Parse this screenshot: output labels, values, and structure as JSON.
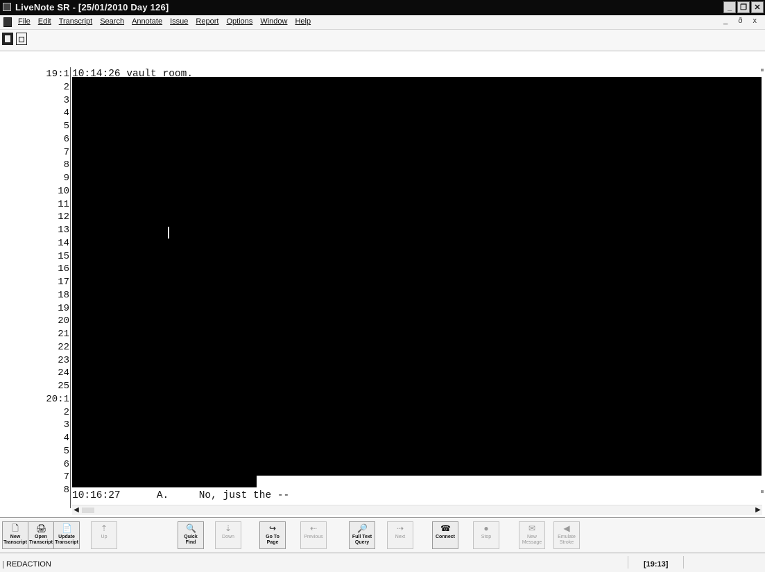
{
  "window": {
    "title": "LiveNote SR - [25/01/2010  Day 126]",
    "controls": [
      "minimize",
      "restore",
      "close"
    ]
  },
  "menu": {
    "items": [
      "File",
      "Edit",
      "Transcript",
      "Search",
      "Annotate",
      "Issue",
      "Report",
      "Options",
      "Window",
      "Help"
    ],
    "mdi_controls": "_ ð x"
  },
  "transcript": {
    "line_numbers": [
      "19:1",
      "2",
      "3",
      "4",
      "5",
      "6",
      "7",
      "8",
      "9",
      "10",
      "11",
      "12",
      "13",
      "14",
      "15",
      "16",
      "17",
      "18",
      "19",
      "20",
      "21",
      "22",
      "23",
      "24",
      "25",
      "20:1",
      "2",
      "3",
      "4",
      "5",
      "6",
      "7",
      "8"
    ],
    "first_line_text": "10:14:26 vault room.",
    "last_line_text": "10:16:27      A.     No, just the --"
  },
  "toolbar": {
    "buttons": [
      {
        "label": "New\nTranscript",
        "icon": "new-transcript-icon",
        "enabled": true
      },
      {
        "label": "Open\nTranscript",
        "icon": "open-transcript-icon",
        "enabled": true
      },
      {
        "label": "Update\nTranscript",
        "icon": "update-transcript-icon",
        "enabled": true
      },
      {
        "label": "Up",
        "icon": "up-icon",
        "enabled": false
      },
      {
        "label": "Quick\nFind",
        "icon": "quick-find-icon",
        "enabled": true
      },
      {
        "label": "Down",
        "icon": "down-icon",
        "enabled": false
      },
      {
        "label": "Go To Page",
        "icon": "go-to-page-icon",
        "enabled": true
      },
      {
        "label": "Previous",
        "icon": "previous-icon",
        "enabled": false
      },
      {
        "label": "Full Text\nQuery",
        "icon": "full-text-query-icon",
        "enabled": true
      },
      {
        "label": "Next",
        "icon": "next-icon",
        "enabled": false
      },
      {
        "label": "Connect",
        "icon": "connect-icon",
        "enabled": true
      },
      {
        "label": "Stop",
        "icon": "stop-icon",
        "enabled": false
      },
      {
        "label": "New\nMessage",
        "icon": "new-message-icon",
        "enabled": false
      },
      {
        "label": "Emulate\nStroke",
        "icon": "emulate-stroke-icon",
        "enabled": false
      }
    ]
  },
  "status": {
    "left_text": "REDACTION",
    "position": "[19:13]"
  }
}
